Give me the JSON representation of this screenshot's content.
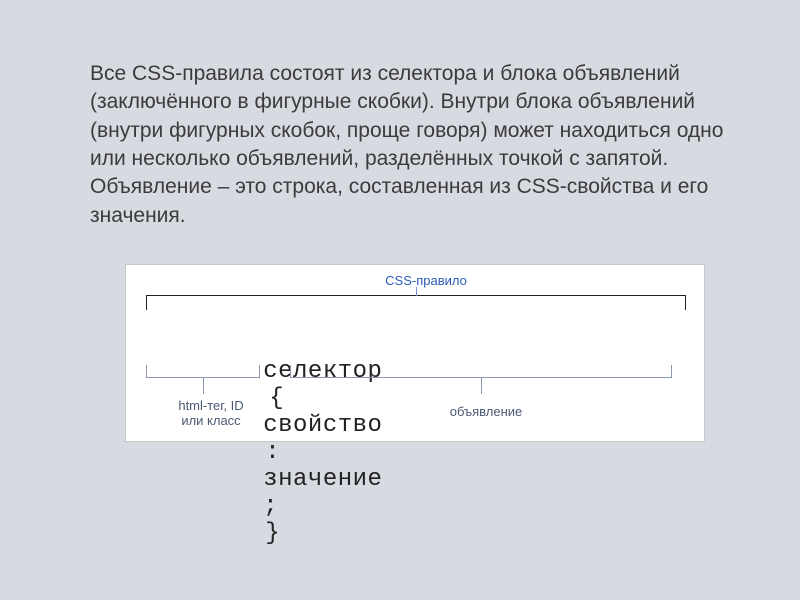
{
  "paragraph": "Все CSS-правила состоят из селектора и блока объявлений (заключённого в фигурные скобки). Внутри блока объявлений (внутри фигурных скобок, проще говоря) может находиться одно или несколько объявлений, разделённых точкой с запятой. Объявление – это строка, составленная из CSS-свойства и его значения.",
  "diagram": {
    "labels": {
      "top": "CSS-правило",
      "bottom_left": "html-тег, ID\nили класс",
      "bottom_right": "объявление"
    },
    "tokens": {
      "selector": "селектор",
      "brace_open": "{",
      "property": "свойство",
      "colon": ":",
      "value": "значение",
      "semicolon": ";",
      "brace_close": "}"
    }
  }
}
